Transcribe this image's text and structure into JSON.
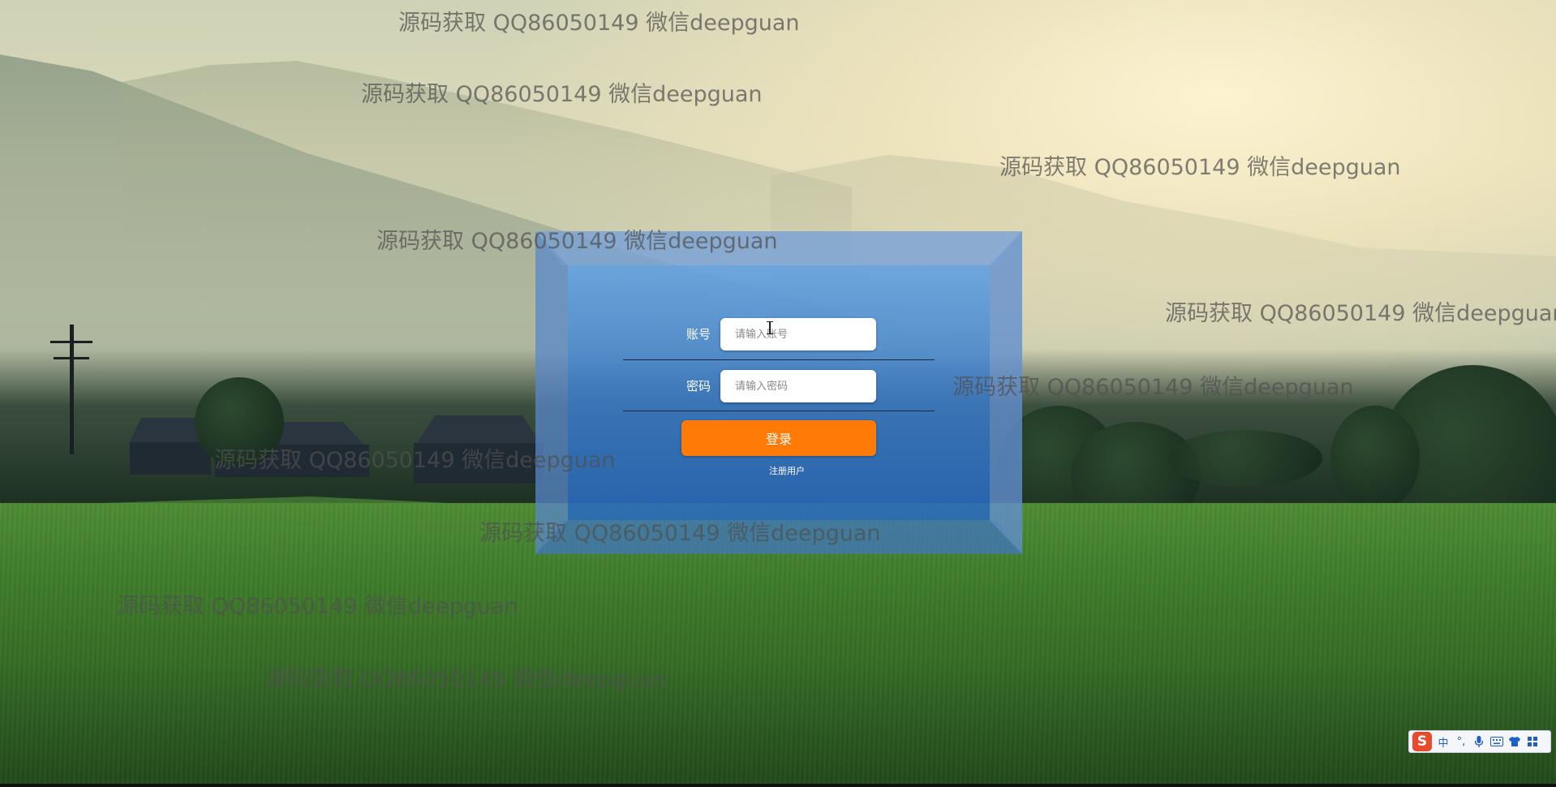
{
  "login": {
    "account_label": "账号",
    "account_placeholder": "请输入账号",
    "password_label": "密码",
    "password_placeholder": "请输入密码",
    "login_button_label": "登录",
    "register_link_label": "注册用户",
    "login_button_color": "#ff7a06"
  },
  "watermarks": [
    "源码获取 QQ86050149 微信deepguan",
    "源码获取 QQ86050149 微信deepguan",
    "源码获取 QQ86050149 微信deepguan",
    "源码获取 QQ86050149 微信deepguan",
    "源码获取 QQ86050149 微信deepguan",
    "源码获取 QQ86050149 微信deepguan",
    "源码获取 QQ86050149 微信deepguan",
    "源码获取 QQ86050149 微信deepguan",
    "源码获取 QQ86050149 微信deepguan",
    "源码获取 QQ86050149 微信deepguan"
  ],
  "ime_toolbar": {
    "logo": "S",
    "items": [
      "中",
      "°,",
      "mic-icon",
      "keyboard-icon",
      "shirt-icon",
      "grid-icon"
    ],
    "mode_label": "中",
    "punct_label": "°,"
  }
}
